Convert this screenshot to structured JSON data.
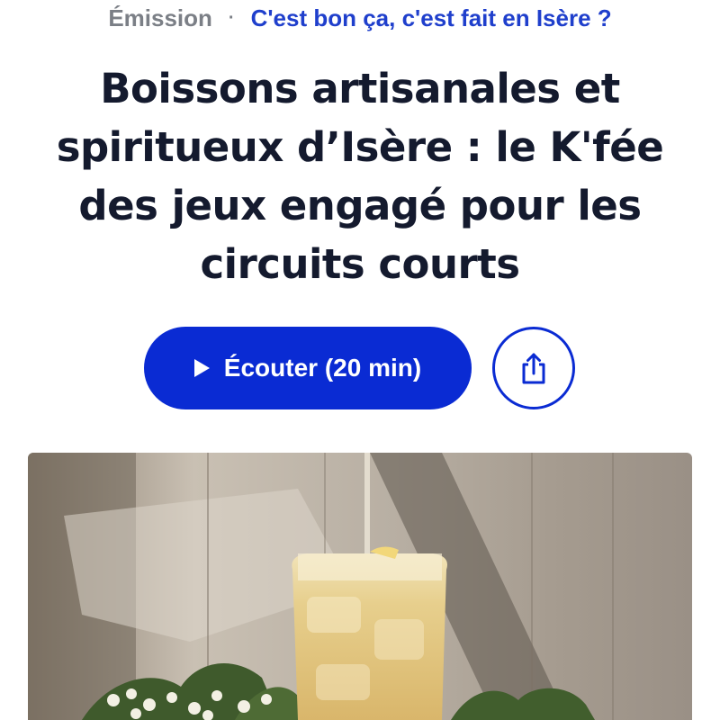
{
  "breadcrumb": {
    "kind": "Émission",
    "separator": "·",
    "show_title": "C'est bon ça, c'est fait en Isère ?"
  },
  "article": {
    "title": "Boissons artisanales et spiritueux d’Isère : le K'fée des jeux engagé pour les circuits courts"
  },
  "actions": {
    "listen_label": "Écouter (20 min)",
    "play_icon": "play-icon",
    "share_icon": "share-icon"
  },
  "colors": {
    "accent": "#0a2bd3",
    "link": "#1f3fcc",
    "title": "#141a2e",
    "muted": "#7b7f86"
  }
}
